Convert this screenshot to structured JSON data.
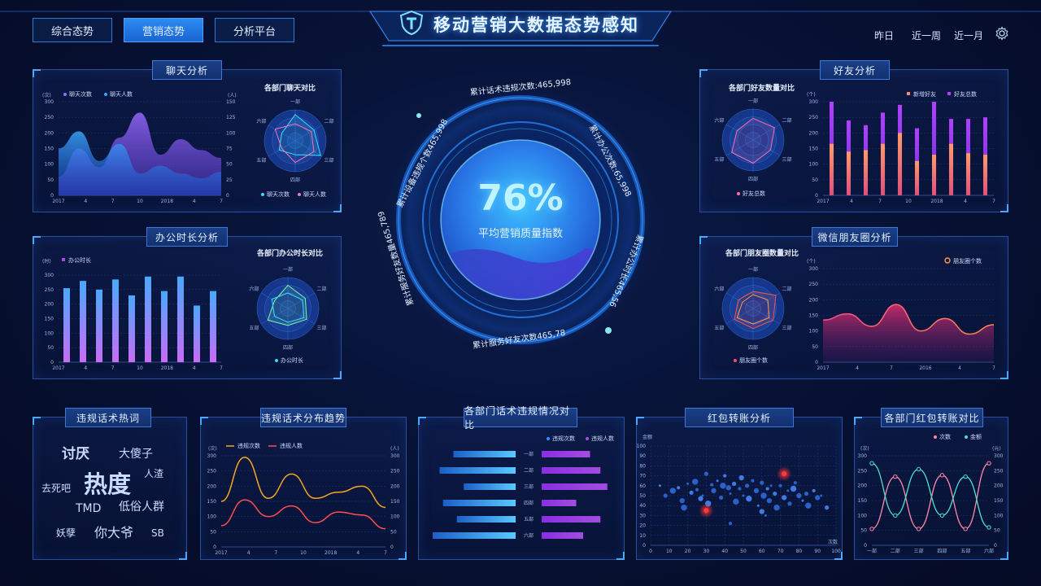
{
  "nav": {
    "tabs": [
      {
        "label": "综合态势",
        "active": false
      },
      {
        "label": "营销态势",
        "active": true
      },
      {
        "label": "分析平台",
        "active": false
      }
    ]
  },
  "header": {
    "title": "移动营销大数据态势感知",
    "time_filters": [
      "昨日",
      "近一周",
      "近一月"
    ]
  },
  "center": {
    "percent": "76%",
    "label": "平均营销质量指数",
    "ring_texts": [
      "累计话术违规次数:465,998",
      "累计办公次数:65,998",
      "累计办公时长465,56",
      "累计服务好友次数465,78",
      "累计服务好友数量465,789",
      "累计设备违规个数465,998"
    ]
  },
  "panels": {
    "chat": {
      "title": "聊天分析",
      "radar_title": "各部门聊天对比",
      "legend": [
        "聊天次数",
        "聊天人数"
      ],
      "left_unit": "(次)",
      "right_unit": "(人)",
      "radar_legend": [
        "聊天次数",
        "聊天人数"
      ]
    },
    "office": {
      "title": "办公时长分析",
      "radar_title": "各部门办公时长对比",
      "legend": [
        "办公时长"
      ],
      "unit": "(时)",
      "radar_legend": [
        "办公时长"
      ]
    },
    "friends": {
      "title": "好友分析",
      "radar_title": "各部门好友数量对比",
      "legend": [
        "新增好友",
        "好友总数"
      ],
      "unit": "(个)",
      "radar_legend": [
        "好友总数"
      ]
    },
    "moments": {
      "title": "微信朋友圈分析",
      "radar_title": "各部门朋友圈数量对比",
      "legend": [
        "朋友圈个数"
      ],
      "unit": "(个)",
      "radar_legend": [
        "朋友圈个数"
      ]
    },
    "words": {
      "title": "违规话术热词"
    },
    "trend": {
      "title": "违规话术分布趋势",
      "legend": [
        "违规次数",
        "违规人数"
      ],
      "left_unit": "(次)",
      "right_unit": "(人)"
    },
    "dept_compare": {
      "title": "各部门话术违规情况对比",
      "legend": [
        "违规次数",
        "违规人数"
      ]
    },
    "redpacket": {
      "title": "红包转账分析",
      "y_unit": "金额",
      "x_unit": "次数"
    },
    "redpacket_dept": {
      "title": "各部门红包转账对比",
      "legend": [
        "次数",
        "金额"
      ],
      "left_unit": "(次)",
      "right_unit": "(元)"
    }
  },
  "radar_axes": [
    "一部",
    "二部",
    "三部",
    "四部",
    "五部",
    "六部"
  ],
  "hot_words": [
    {
      "text": "讨厌",
      "color": "#f5a623"
    },
    {
      "text": "大傻子",
      "color": "#4e7dff"
    },
    {
      "text": "人渣",
      "color": "#f5c542"
    },
    {
      "text": "去死吧",
      "color": "#2f74d8"
    },
    {
      "text": "热度",
      "color": "#3b8cff"
    },
    {
      "text": "低俗人群",
      "color": "#a24de0"
    },
    {
      "text": "TMD",
      "color": "#2f74d8"
    },
    {
      "text": "妖孽",
      "color": "#2aa6e0"
    },
    {
      "text": "你大爷",
      "color": "#e0343a"
    },
    {
      "text": "SB",
      "color": "#2f74d8"
    }
  ],
  "chart_data": [
    {
      "type": "area",
      "name": "chat",
      "x_ticks": [
        "2017",
        "4",
        "7",
        "10",
        "2018",
        "4",
        "7"
      ],
      "y_ticks": [
        "0",
        "50",
        "100",
        "150",
        "200",
        "250",
        "300"
      ],
      "y2_ticks": [
        "0",
        "25",
        "50",
        "75",
        "100",
        "125",
        "150"
      ],
      "ylim": [
        0,
        300
      ],
      "series": [
        {
          "name": "聊天次数",
          "values": [
            150,
            205,
            110,
            165,
            70,
            95,
            70,
            55,
            75
          ]
        },
        {
          "name": "聊天人数",
          "values": [
            60,
            150,
            90,
            185,
            265,
            130,
            180,
            145,
            120
          ]
        }
      ]
    },
    {
      "type": "bar",
      "name": "office",
      "categories": [
        "2017",
        "",
        "4",
        "",
        "7",
        "",
        "10",
        "",
        "2018",
        "",
        "4",
        "",
        "7"
      ],
      "x_ticks": [
        "2017",
        "4",
        "7",
        "10",
        "2018",
        "4",
        "7"
      ],
      "y_ticks": [
        "0",
        "50",
        "100",
        "150",
        "200",
        "250",
        "300"
      ],
      "ylim": [
        0,
        300
      ],
      "series": [
        {
          "name": "办公时长",
          "values": [
            255,
            280,
            250,
            285,
            230,
            295,
            245,
            295,
            195,
            245
          ]
        }
      ]
    },
    {
      "type": "bar",
      "name": "friends",
      "x_ticks": [
        "2017",
        "4",
        "7",
        "10",
        "2018",
        "4",
        "7"
      ],
      "y_ticks": [
        "0",
        "50",
        "100",
        "150",
        "200",
        "250",
        "300"
      ],
      "ylim": [
        0,
        300
      ],
      "series": [
        {
          "name": "新增好友",
          "values": [
            165,
            140,
            145,
            165,
            200,
            110,
            130,
            165,
            135,
            130
          ]
        },
        {
          "name": "好友总数",
          "values": [
            300,
            240,
            225,
            265,
            290,
            215,
            300,
            245,
            245,
            250
          ]
        }
      ]
    },
    {
      "type": "area",
      "name": "moments",
      "x_ticks": [
        "2017",
        "4",
        "7",
        "2016",
        "4",
        "7"
      ],
      "y_ticks": [
        "0",
        "50",
        "100",
        "150",
        "200",
        "250",
        "300"
      ],
      "ylim": [
        0,
        300
      ],
      "series": [
        {
          "name": "朋友圈个数",
          "values": [
            135,
            155,
            115,
            185,
            100,
            140,
            90,
            120
          ]
        }
      ]
    },
    {
      "type": "line",
      "name": "trend",
      "x_ticks": [
        "2017",
        "4",
        "7",
        "10",
        "2018",
        "4",
        "7"
      ],
      "y_ticks": [
        "0",
        "50",
        "100",
        "150",
        "200",
        "250",
        "300"
      ],
      "y2_ticks": [
        "0",
        "50",
        "100",
        "150",
        "200",
        "250",
        "300"
      ],
      "ylim": [
        0,
        300
      ],
      "series": [
        {
          "name": "违规次数",
          "values": [
            150,
            295,
            160,
            240,
            160,
            180,
            200,
            130
          ]
        },
        {
          "name": "违规人数",
          "values": [
            70,
            155,
            100,
            135,
            80,
            115,
            105,
            60
          ]
        }
      ]
    },
    {
      "type": "bar",
      "name": "dept_compare",
      "categories": [
        "一部",
        "二部",
        "三部",
        "四部",
        "五部",
        "六部"
      ],
      "series": [
        {
          "name": "违规次数",
          "values": [
            0.9,
            1.1,
            0.75,
            1.05,
            0.85,
            1.2
          ]
        },
        {
          "name": "违规人数",
          "values": [
            0.7,
            0.85,
            0.95,
            0.5,
            0.85,
            0.6
          ]
        }
      ]
    },
    {
      "type": "scatter",
      "name": "redpacket",
      "x_ticks": [
        "0",
        "10",
        "20",
        "30",
        "40",
        "50",
        "60",
        "70",
        "80",
        "90",
        "100"
      ],
      "y_ticks": [
        "0",
        "10",
        "20",
        "30",
        "40",
        "50",
        "60",
        "70",
        "80",
        "90",
        "100"
      ],
      "xlim": [
        0,
        100
      ],
      "ylim": [
        0,
        100
      ],
      "points": [
        [
          5,
          60
        ],
        [
          8,
          50
        ],
        [
          12,
          55
        ],
        [
          15,
          58
        ],
        [
          17,
          45
        ],
        [
          20,
          62
        ],
        [
          22,
          53
        ],
        [
          24,
          64
        ],
        [
          25,
          56
        ],
        [
          27,
          47
        ],
        [
          28,
          50
        ],
        [
          30,
          72
        ],
        [
          31,
          42
        ],
        [
          33,
          61
        ],
        [
          34,
          55
        ],
        [
          36,
          65
        ],
        [
          38,
          48
        ],
        [
          39,
          60
        ],
        [
          40,
          70
        ],
        [
          42,
          58
        ],
        [
          43,
          52
        ],
        [
          45,
          62
        ],
        [
          46,
          44
        ],
        [
          48,
          57
        ],
        [
          49,
          68
        ],
        [
          50,
          50
        ],
        [
          52,
          60
        ],
        [
          53,
          47
        ],
        [
          55,
          65
        ],
        [
          57,
          55
        ],
        [
          58,
          40
        ],
        [
          60,
          63
        ],
        [
          61,
          50
        ],
        [
          63,
          57
        ],
        [
          64,
          45
        ],
        [
          65,
          60
        ],
        [
          67,
          52
        ],
        [
          68,
          38
        ],
        [
          70,
          60
        ],
        [
          72,
          48
        ],
        [
          74,
          55
        ],
        [
          75,
          42
        ],
        [
          77,
          57
        ],
        [
          78,
          63
        ],
        [
          80,
          50
        ],
        [
          82,
          45
        ],
        [
          84,
          52
        ],
        [
          85,
          40
        ],
        [
          88,
          55
        ],
        [
          90,
          48
        ],
        [
          92,
          50
        ],
        [
          95,
          38
        ],
        [
          18,
          38
        ],
        [
          43,
          22
        ],
        [
          60,
          34
        ],
        [
          62,
          30
        ]
      ],
      "highlights": [
        [
          72,
          72
        ],
        [
          30,
          35
        ]
      ]
    },
    {
      "type": "line",
      "name": "redpacket_dept",
      "categories": [
        "一部",
        "二部",
        "三部",
        "四部",
        "五部",
        "六部"
      ],
      "y_ticks": [
        "0",
        "50",
        "100",
        "150",
        "200",
        "250",
        "300"
      ],
      "y2_ticks": [
        "0",
        "50",
        "100",
        "150",
        "200",
        "250",
        "300"
      ],
      "ylim": [
        0,
        300
      ],
      "series": [
        {
          "name": "次数",
          "values": [
            55,
            230,
            55,
            235,
            55,
            275
          ]
        },
        {
          "name": "金额",
          "values": [
            275,
            100,
            255,
            100,
            230,
            60
          ]
        }
      ]
    }
  ]
}
